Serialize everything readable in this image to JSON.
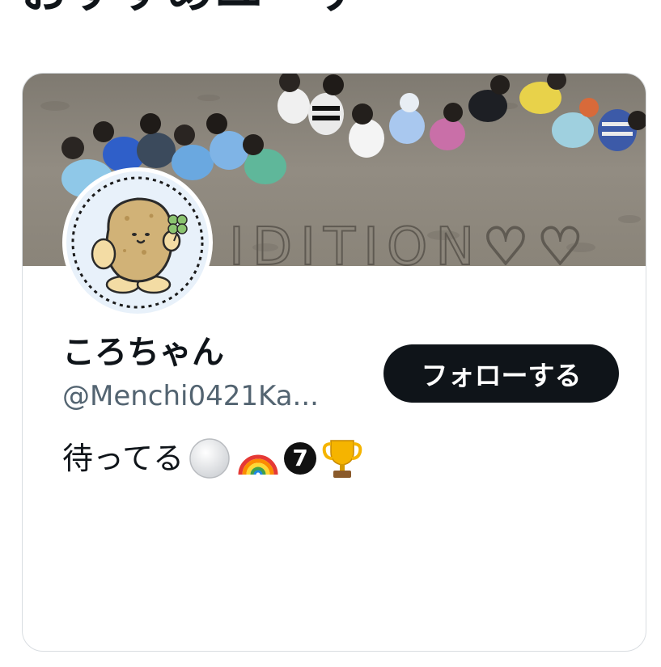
{
  "heading": {
    "text": "おすすめユーザー"
  },
  "profile": {
    "display_name": "ころちゃん",
    "handle": "@Menchi0421Ka...",
    "bio_text": "待ってる",
    "bio_badge": "7",
    "banner_text": "IDITION♡♡",
    "icons": {
      "bio_emojis": [
        "white-circle-icon",
        "rainbow-icon",
        "seven-badge-icon",
        "trophy-icon"
      ],
      "avatar": "potato-character-icon"
    }
  },
  "actions": {
    "follow_label": "フォローする"
  },
  "colors": {
    "button_bg": "#0f1419",
    "handle": "#536471",
    "card_border": "#d9dde1",
    "avatar_bg": "#e8f1fa"
  }
}
